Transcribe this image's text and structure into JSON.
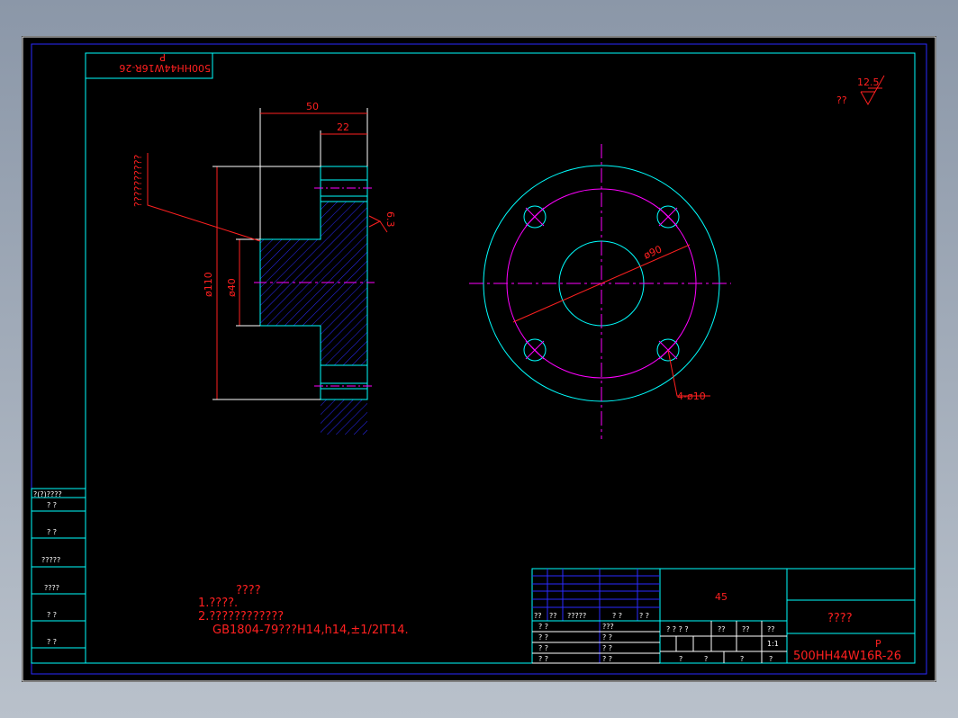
{
  "drawing": {
    "part_code": "500HH44W16R-26",
    "part_code_suffix": "P",
    "material": "45",
    "title_red": "????",
    "scale": "1:1",
    "roughness": {
      "value": "12.5",
      "label": "??"
    },
    "notes": {
      "heading": "????",
      "line1": "1.????.",
      "line2": "2.????????????",
      "line3": "GB1804-79???H14,h14,±1/2IT14."
    },
    "dims": {
      "d50": "50",
      "d22": "22",
      "d110": "ø110",
      "d40": "ø40",
      "d90": "ø90",
      "holes": "4-ø10",
      "face_roughness": "6.3",
      "leader_text": "??????????"
    },
    "left_table": [
      "?(?)????",
      "?  ?",
      "?  ?",
      "?????",
      "????",
      "?  ?",
      "?  ?"
    ],
    "title_block": {
      "row_headers": [
        "??",
        "??",
        "?????",
        "? ?",
        "? ?"
      ],
      "left_rows": [
        [
          "? ?",
          "???"
        ],
        [
          "? ?",
          "? ?"
        ],
        [
          "? ?",
          "? ?"
        ],
        [
          "? ?",
          "? ?"
        ]
      ],
      "mid_headers": [
        "? ? ? ?",
        "??",
        "??",
        "??"
      ],
      "bottom_cells": [
        "?",
        "?",
        "?",
        "?"
      ]
    }
  }
}
